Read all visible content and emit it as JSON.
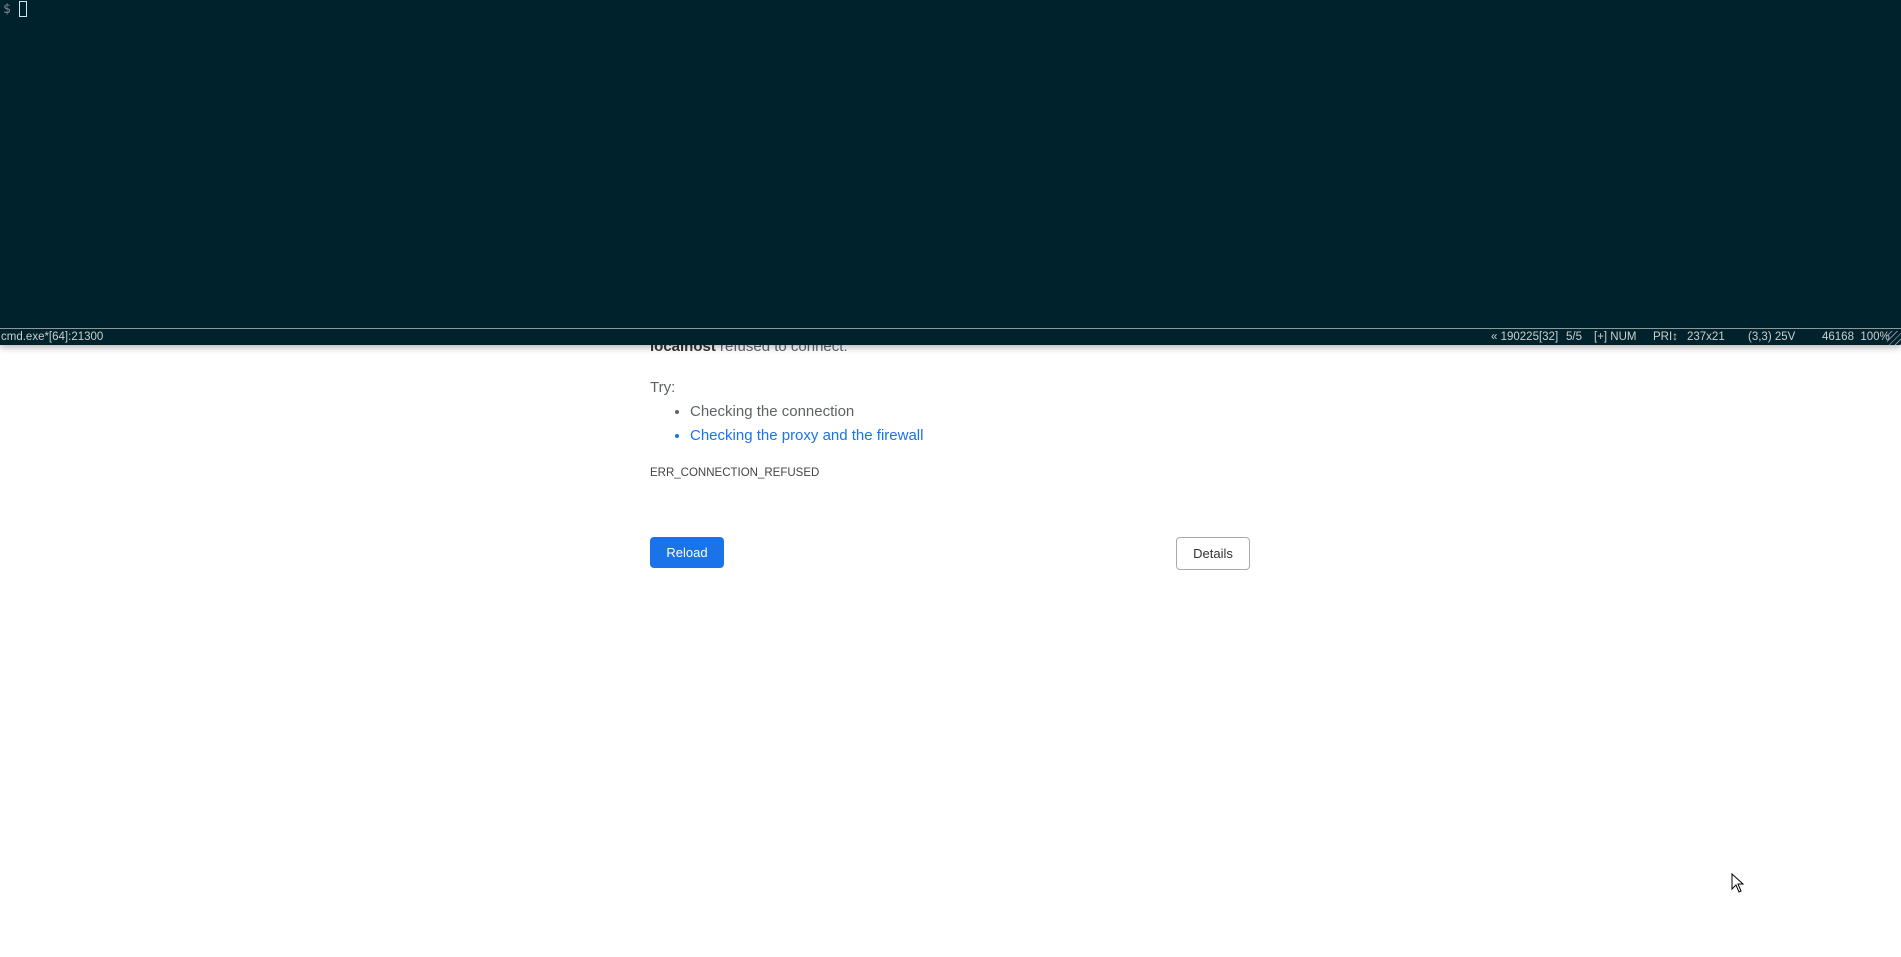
{
  "terminal": {
    "prompt": "$",
    "status": {
      "title": "cmd.exe*[64]:21300",
      "items": [
        "« 190225[32]",
        "5/5",
        "[+] NUM",
        "PRI↕",
        "237x21",
        "(3,3) 25V",
        "46168  100%"
      ]
    }
  },
  "page": {
    "host": "localhost",
    "message": " refused to connect.",
    "try_label": "Try:",
    "suggestions": [
      "Checking the connection",
      "Checking the proxy and the firewall"
    ],
    "error_code": "ERR_CONNECTION_REFUSED",
    "reload_label": "Reload",
    "details_label": "Details"
  },
  "colors": {
    "terminal_bg": "#00222c",
    "accent": "#1a73e8"
  }
}
